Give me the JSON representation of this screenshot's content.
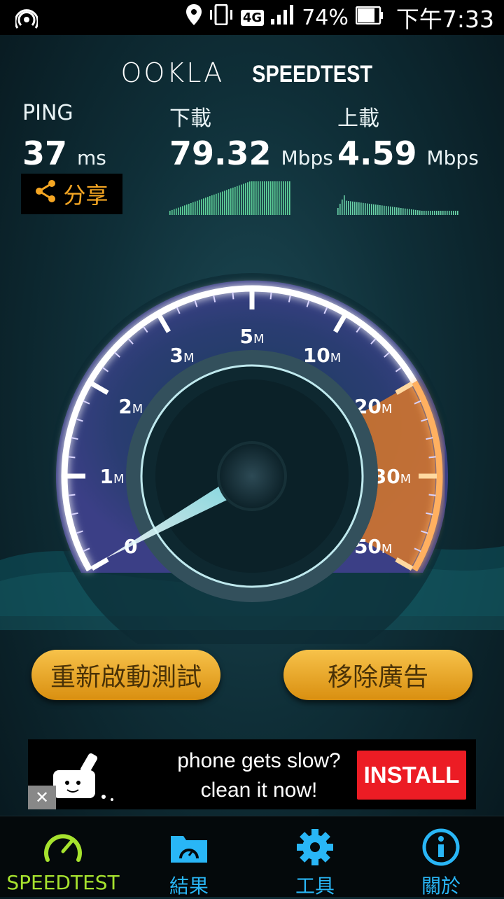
{
  "status_bar": {
    "network_type": "4G",
    "battery_percent": "74%",
    "time": "下午7:33",
    "icons": [
      "hotspot-icon",
      "location-icon",
      "vibrate-icon",
      "signal-icon",
      "battery-icon"
    ]
  },
  "brand": {
    "ookla": "OOKLA",
    "speedtest": "SPEEDTEST"
  },
  "metrics": {
    "ping": {
      "label": "PING",
      "value": "37",
      "unit": "ms"
    },
    "download": {
      "label": "下載",
      "value": "79.32",
      "unit": "Mbps"
    },
    "upload": {
      "label": "上載",
      "value": "4.59",
      "unit": "Mbps"
    }
  },
  "share": {
    "label": "分享",
    "icon": "share-icon"
  },
  "gauge": {
    "ticks": [
      {
        "num": "0",
        "unit": ""
      },
      {
        "num": "1",
        "unit": "M"
      },
      {
        "num": "2",
        "unit": "M"
      },
      {
        "num": "3",
        "unit": "M"
      },
      {
        "num": "5",
        "unit": "M"
      },
      {
        "num": "10",
        "unit": "M"
      },
      {
        "num": "20",
        "unit": "M"
      },
      {
        "num": "30",
        "unit": "M"
      },
      {
        "num": "50",
        "unit": "M"
      }
    ]
  },
  "buttons": {
    "restart": "重新啟動測試",
    "remove_ads": "移除廣告"
  },
  "ad": {
    "line1": "phone gets slow?",
    "line2": "clean it now!",
    "install": "INSTALL",
    "close": "✕"
  },
  "nav": [
    {
      "label": "SPEEDTEST",
      "icon": "speedometer-icon",
      "active": true
    },
    {
      "label": "結果",
      "icon": "results-folder-icon",
      "active": false
    },
    {
      "label": "工具",
      "icon": "gear-icon",
      "active": false
    },
    {
      "label": "關於",
      "icon": "info-icon",
      "active": false
    }
  ],
  "colors": {
    "accent_orange": "#f5a623",
    "nav_active": "#a6e22e",
    "nav_icon": "#29b6f6",
    "install_red": "#ec1c24"
  }
}
